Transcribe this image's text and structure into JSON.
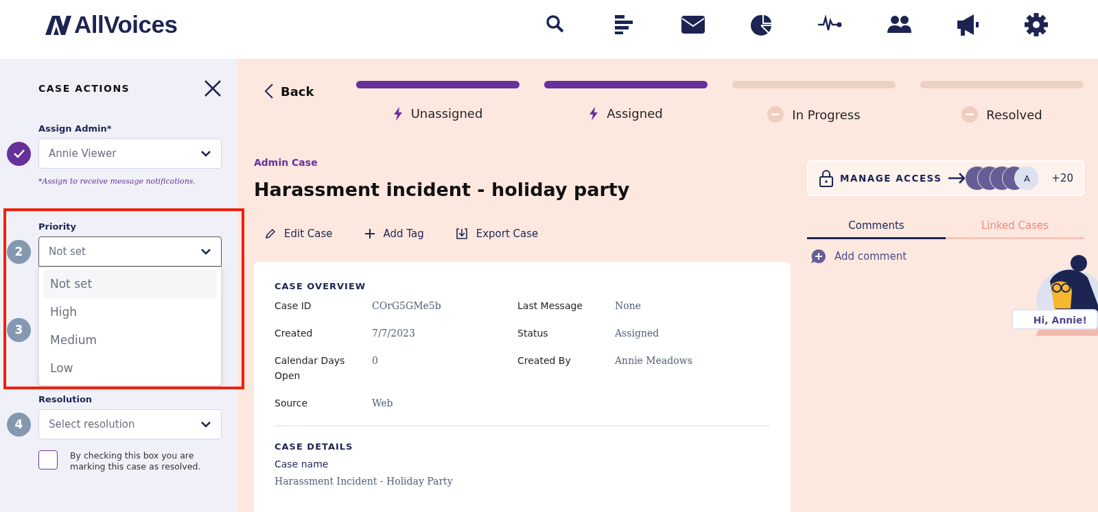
{
  "header": {
    "logo": "AllVoices"
  },
  "sidebar": {
    "title": "CASE ACTIONS",
    "steps": [
      {
        "done": true,
        "label": "Assign Admin*",
        "value": "Annie Viewer",
        "hint": "*Assign to receive message notifications."
      },
      {
        "marker": "2",
        "done": false,
        "label": "Priority",
        "value": "Not set",
        "open": true,
        "options": [
          {
            "label": "Not set",
            "selected": true
          },
          {
            "label": "High",
            "selected": false
          },
          {
            "label": "Medium",
            "selected": false
          },
          {
            "label": "Low",
            "selected": false
          }
        ]
      },
      {
        "marker": "3",
        "done": false
      },
      {
        "marker": "4",
        "done": false,
        "label": "Resolution",
        "placeholder": "Select resolution"
      }
    ],
    "confirm": {
      "checked": false,
      "text": "By checking this box you are marking this case as resolved."
    }
  },
  "back": "Back",
  "stages": [
    {
      "label": "Unassigned",
      "done": true
    },
    {
      "label": "Assigned",
      "done": true
    },
    {
      "label": "In Progress",
      "done": false
    },
    {
      "label": "Resolved",
      "done": false
    }
  ],
  "case": {
    "type": "Admin Case",
    "title": "Harassment incident - holiday party",
    "actions": [
      {
        "kind": "edit",
        "label": "Edit Case"
      },
      {
        "kind": "tag",
        "label": "Add Tag"
      },
      {
        "kind": "export",
        "label": "Export Case"
      }
    ],
    "overview": {
      "heading": "CASE OVERVIEW",
      "fields": [
        {
          "label": "Case ID",
          "value": "COrG5GMe5b"
        },
        {
          "label": "Last Message",
          "value": "None"
        },
        {
          "label": "Created",
          "value": "7/7/2023"
        },
        {
          "label": "Status",
          "value": "Assigned"
        },
        {
          "label": "Calendar Days Open",
          "value": "0"
        },
        {
          "label": "Created By",
          "value": "Annie Meadows"
        },
        {
          "label": "Source",
          "value": "Web"
        }
      ]
    },
    "details": {
      "heading": "CASE DETAILS",
      "fields": [
        {
          "label": "Case name",
          "value": "Harassment Incident - Holiday Party"
        }
      ]
    }
  },
  "access": {
    "label": "MANAGE ACCESS",
    "avatars": [
      {
        "kind": "photo"
      },
      {
        "kind": "photo"
      },
      {
        "kind": "photo"
      },
      {
        "kind": "photo"
      },
      {
        "kind": "initial",
        "initial": "A"
      }
    ],
    "more": "+20"
  },
  "tabs": [
    {
      "label": "Comments",
      "selected": true
    },
    {
      "label": "Linked Cases",
      "selected": false
    }
  ],
  "add_comment": "Add comment",
  "greeting": "Hi, Annie!"
}
